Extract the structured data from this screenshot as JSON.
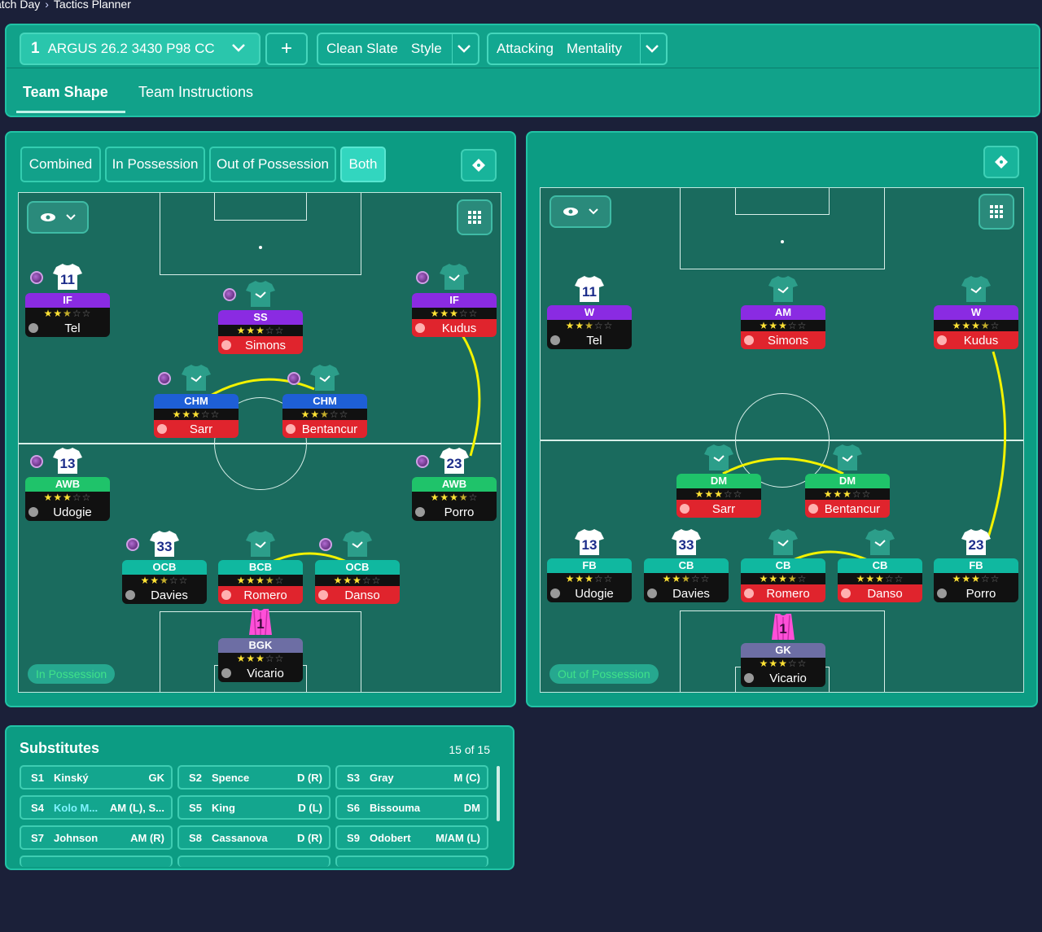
{
  "breadcrumb": {
    "parent": "atch Day",
    "current": "Tactics Planner"
  },
  "tactic": {
    "number": "1",
    "name": "ARGUS 26.2 3430 P98 CC"
  },
  "style": {
    "value": "Clean Slate",
    "label": "Style"
  },
  "mentality": {
    "value": "Attacking",
    "label": "Mentality"
  },
  "tabs": {
    "shape": "Team Shape",
    "instructions": "Team Instructions"
  },
  "filters": {
    "combined": "Combined",
    "in_possession": "In Possession",
    "out_possession": "Out of Possession",
    "both": "Both"
  },
  "left_pitch": {
    "label": "In Possession",
    "players": [
      {
        "shirt": "11",
        "role": "IF",
        "stars": 2.5,
        "name": "Tel"
      },
      {
        "shirt": "",
        "role": "SS",
        "stars": 3,
        "name": "Simons"
      },
      {
        "shirt": "",
        "role": "IF",
        "stars": 3,
        "name": "Kudus"
      },
      {
        "shirt": "",
        "role": "CHM",
        "stars": 3,
        "name": "Sarr"
      },
      {
        "shirt": "",
        "role": "CHM",
        "stars": 2.5,
        "name": "Bentancur"
      },
      {
        "shirt": "13",
        "role": "AWB",
        "stars": 3,
        "name": "Udogie"
      },
      {
        "shirt": "23",
        "role": "AWB",
        "stars": 3.5,
        "name": "Porro"
      },
      {
        "shirt": "33",
        "role": "OCB",
        "stars": 2.5,
        "name": "Davies"
      },
      {
        "shirt": "",
        "role": "BCB",
        "stars": 3.5,
        "name": "Romero"
      },
      {
        "shirt": "",
        "role": "OCB",
        "stars": 3,
        "name": "Danso"
      },
      {
        "shirt": "1",
        "role": "BGK",
        "stars": 3,
        "name": "Vicario"
      }
    ]
  },
  "right_pitch": {
    "label": "Out of Possession",
    "players": [
      {
        "shirt": "11",
        "role": "W",
        "stars": 2.5,
        "name": "Tel"
      },
      {
        "shirt": "",
        "role": "AM",
        "stars": 3,
        "name": "Simons"
      },
      {
        "shirt": "",
        "role": "W",
        "stars": 3.5,
        "name": "Kudus"
      },
      {
        "shirt": "",
        "role": "DM",
        "stars": 3,
        "name": "Sarr"
      },
      {
        "shirt": "",
        "role": "DM",
        "stars": 3,
        "name": "Bentancur"
      },
      {
        "shirt": "13",
        "role": "FB",
        "stars": 3,
        "name": "Udogie"
      },
      {
        "shirt": "33",
        "role": "CB",
        "stars": 2.5,
        "name": "Davies"
      },
      {
        "shirt": "",
        "role": "CB",
        "stars": 3.5,
        "name": "Romero"
      },
      {
        "shirt": "",
        "role": "CB",
        "stars": 3,
        "name": "Danso"
      },
      {
        "shirt": "23",
        "role": "FB",
        "stars": 3,
        "name": "Porro"
      },
      {
        "shirt": "1",
        "role": "GK",
        "stars": 3,
        "name": "Vicario"
      }
    ]
  },
  "substitutes": {
    "title": "Substitutes",
    "count": "15 of 15",
    "items": [
      {
        "slot": "S1",
        "name": "Kinský",
        "pos": "GK"
      },
      {
        "slot": "S2",
        "name": "Spence",
        "pos": "D (R)"
      },
      {
        "slot": "S3",
        "name": "Gray",
        "pos": "M (C)"
      },
      {
        "slot": "S4",
        "name": "Kolo M...",
        "pos": "AM (L), S..."
      },
      {
        "slot": "S5",
        "name": "King",
        "pos": "D (L)"
      },
      {
        "slot": "S6",
        "name": "Bissouma",
        "pos": "DM"
      },
      {
        "slot": "S7",
        "name": "Johnson",
        "pos": "AM (R)"
      },
      {
        "slot": "S8",
        "name": "Cassanova",
        "pos": "D (R)"
      },
      {
        "slot": "S9",
        "name": "Odobert",
        "pos": "M/AM (L)"
      }
    ]
  },
  "colors": {
    "accent": "#11a28a",
    "background": "#1b2039",
    "pitch": "#1a6b5e",
    "link_line": "#f2f200"
  }
}
